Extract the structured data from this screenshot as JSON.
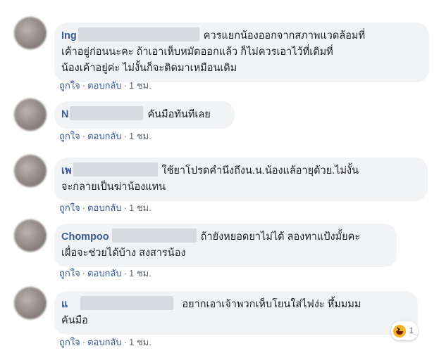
{
  "comments": [
    {
      "author": "Ing",
      "text_line1": "ควรแยกน้องออกจากสภาพแวดล้อมที่",
      "text_rest": [
        "เค้าอยู่ก่อนนะคะ ถ้าเอาเห็บหมัดออกแล้ว ก็ไม่ควรเอาไว้ที่เดิมที่",
        "น้องเค้าอยู่ค่ะ ไม่งั้นก็จะติดมาเหมือนเดิม"
      ],
      "like": "ถูกใจ",
      "reply": "ตอบกลับ",
      "time": "1 ชม."
    },
    {
      "author": "N",
      "text_line1": "คันมือทันทีเลย",
      "text_rest": [],
      "like": "ถูกใจ",
      "reply": "ตอบกลับ",
      "time": "1 ชม."
    },
    {
      "author": "เพ",
      "text_line1": "ใช้ยาโปรดคำนึงถึงน.น.น้องแล้อายุด้วย.ไม่งั้น",
      "text_rest": [
        "จะกลายเป็นฆ่าน้องแทน"
      ],
      "like": "ถูกใจ",
      "reply": "ตอบกลับ",
      "time": "1 ชม."
    },
    {
      "author": "Chompoo",
      "text_line1": "ถ้ายังหยอดยาไม่ได้ ลองทาแป้งมั้ยคะ",
      "text_rest": [
        "เผื่อจะช่วยได้บ้าง สงสารน้อง"
      ],
      "like": "ถูกใจ",
      "reply": "ตอบกลับ",
      "time": "1 ชม."
    },
    {
      "author": "แ",
      "text_line1": "อยากเอาเจ้าพวกเห็บโยนใส่ไฟง่ะ หึ้มมมม",
      "text_rest": [
        "คันมือ"
      ],
      "like": "ถูกใจ",
      "reply": "ตอบกลับ",
      "time": "1 ชม.",
      "reaction_count": "1"
    }
  ],
  "colors": {
    "link": "#385898",
    "bubble": "#f2f3f5",
    "meta": "#616770"
  },
  "icons": {
    "reaction": "haha-icon"
  }
}
